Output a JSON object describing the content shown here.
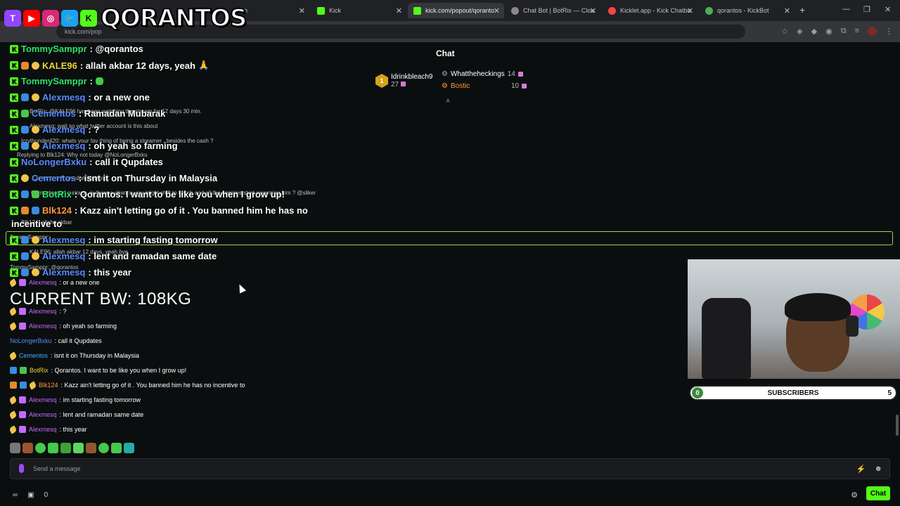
{
  "browser": {
    "tabs": [
      {
        "label": "itch",
        "color": "#9146ff"
      },
      {
        "label": "Kick",
        "color": "#53fc18"
      },
      {
        "label": "kick.com/popout/qoranto",
        "color": "#53fc18"
      },
      {
        "label": "Chat Bot | BotRix — Clou",
        "color": "#888888"
      },
      {
        "label": "Kicklet.app - Kick Chatbo",
        "color": "#ff4444"
      },
      {
        "label": "qorantos - KickBot",
        "color": "#4caf50"
      }
    ],
    "new_tab": "+",
    "minimize": "—",
    "maximize": "❐",
    "close": "✕",
    "address": "kick.com/pop"
  },
  "overlay": {
    "logo_text": "QORANTOS",
    "socials": [
      "T",
      "▶",
      "◎",
      "🐦",
      "K"
    ],
    "bw_label": "CURRENT BW: 108KG"
  },
  "chat": {
    "title": "Chat",
    "gifters": [
      {
        "rank": "1",
        "name": "Idrinkbleach9",
        "count": "27"
      },
      {
        "name": "Whattheheckings",
        "count": "14"
      },
      {
        "name": "Bostic",
        "count": "10"
      }
    ],
    "big_messages": [
      {
        "user": "TommySamppr",
        "text": ": @qorantos",
        "color": "green"
      },
      {
        "user": "KALE96",
        "text": ": allah akbar 12 days, yeah",
        "color": "yellow"
      },
      {
        "user": "TommySamppr",
        "text": ":",
        "color": "green"
      },
      {
        "user": "Alexmesq",
        "text": ": or a new one",
        "color": "blue"
      },
      {
        "user": "Cementos",
        "text": ": Ramadan Mubarak",
        "color": "blue"
      },
      {
        "user": "Alexmesq",
        "text": ": ?",
        "color": "blue"
      },
      {
        "user": "Alexmesq",
        "text": ": oh yeah so farming",
        "color": "blue"
      },
      {
        "user": "NoLongerBxku",
        "text": ": call it Qupdates",
        "color": "blue"
      },
      {
        "user": "Cementos",
        "text": ": isnt it on Thursday in Malaysia",
        "color": "blue"
      },
      {
        "user": "BotRix",
        "text": ": Qorantos. I want to be like you when I grow up!",
        "color": "green"
      },
      {
        "user": "Blk124",
        "text": ": Kazz ain't letting go of it . You banned him he has no",
        "color": "orange"
      },
      {
        "user": "",
        "text": "incentive to",
        "color": "green"
      },
      {
        "user": "Alexmesq",
        "text": ": im starting fasting tomorrow",
        "color": "blue"
      },
      {
        "user": "Alexmesq",
        "text": ": lent and ramadan same date",
        "color": "blue"
      },
      {
        "user": "Alexmesq",
        "text": ": this year",
        "color": "blue"
      }
    ],
    "ghost_messages": [
      "BotRix: @KALE96 has been watching the stream for 12 days 30 min.",
      "Alexmesq: wait so what twitter account is this about",
      "Icrythunder420: whats your fav thing of being a streamer , besides the cash ?",
      "Replying to Blk124: Why not today @NoLongerBxku",
      "Cementos: Ramadan Mubarak",
      "Cementos: im curious , is there a chance you might shift to twitch and all the normies start swarming him ? @sliker",
      "Blk124: allahu akbar",
      "KALE96: allah akbar 12 days, yeah bye",
      "TommySamppr: @qorantos",
      "TommySamppr:"
    ],
    "small_messages": [
      {
        "user": "Alexmesq",
        "text": ": or a new one",
        "color": "purple"
      },
      {
        "user": "Alexmesq",
        "text": ": ?",
        "color": "purple"
      },
      {
        "user": "Alexmesq",
        "text": ": oh yeah so farming",
        "color": "purple"
      },
      {
        "user": "NoLongerBxku",
        "text": ": call it Qupdates",
        "color": "blue"
      },
      {
        "user": "Cementos",
        "text": ": isnt it on Thursday in Malaysia",
        "color": "blue"
      },
      {
        "user": "BotRix",
        "text": ": Qorantos. I want to be like you when I grow up!",
        "color": "yellow"
      },
      {
        "user": "Blk124",
        "text": ": Kazz ain't letting go of it . You banned him he has no incentive to",
        "color": "orange"
      },
      {
        "user": "Alexmesq",
        "text": ": im starting fasting tomorrow",
        "color": "purple"
      },
      {
        "user": "Alexmesq",
        "text": ": lent and ramadan same date",
        "color": "purple"
      },
      {
        "user": "Alexmesq",
        "text": ": this year",
        "color": "purple"
      }
    ],
    "input_placeholder": "Send a message",
    "viewer_count": "0",
    "chat_button": "Chat"
  },
  "subscribers": {
    "current": "0",
    "label": "SUBSCRIBERS",
    "goal": "5",
    "progress": 0
  },
  "colors": {
    "kick_green": "#53fc18",
    "user_green": "#2ee36b",
    "user_blue": "#5a8bff",
    "user_purple": "#c26bff",
    "user_yellow": "#f0d43a",
    "user_orange": "#ff9a3c"
  }
}
